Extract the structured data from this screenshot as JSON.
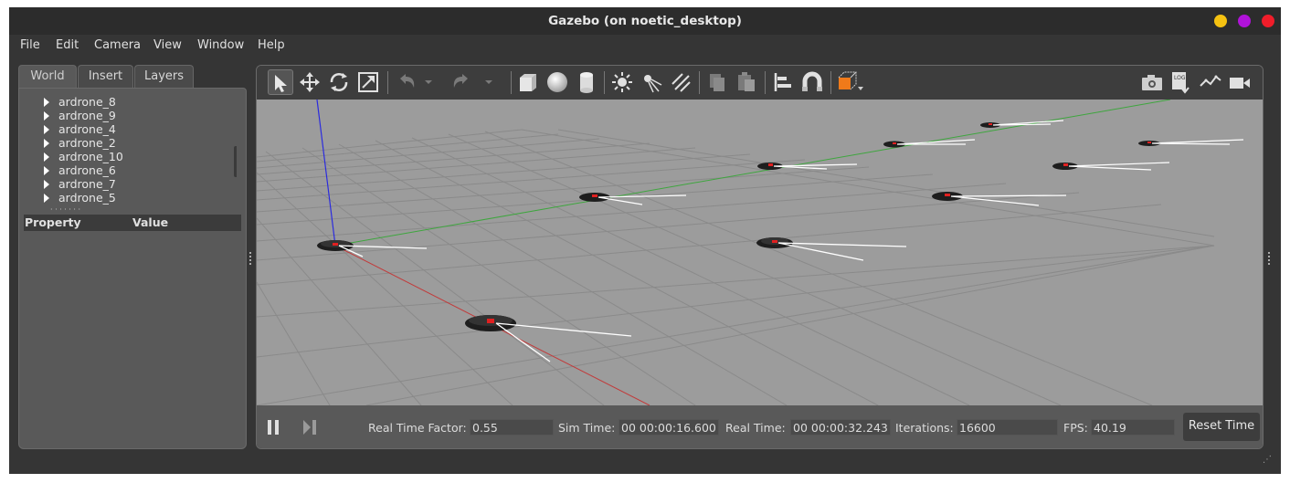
{
  "window": {
    "title": "Gazebo (on noetic_desktop)",
    "buttons": [
      {
        "name": "minimize",
        "color": "#f5c211"
      },
      {
        "name": "maximize",
        "color": "#b012d9"
      },
      {
        "name": "close",
        "color": "#f01d2a"
      }
    ]
  },
  "menu": [
    "File",
    "Edit",
    "Camera",
    "View",
    "Window",
    "Help"
  ],
  "left_panel": {
    "tabs": [
      "World",
      "Insert",
      "Layers"
    ],
    "active_tab": "World",
    "tree_items": [
      "ardrone_8",
      "ardrone_9",
      "ardrone_4",
      "ardrone_2",
      "ardrone_10",
      "ardrone_6",
      "ardrone_7",
      "ardrone_5"
    ],
    "property_header": {
      "property": "Property",
      "value": "Value"
    }
  },
  "toolbar": {
    "tools": [
      "select-mode",
      "translate-mode",
      "rotate-mode",
      "scale-mode",
      "undo",
      "undo-history",
      "redo",
      "redo-history",
      "box",
      "sphere",
      "cylinder",
      "point-light",
      "spot-light",
      "directional-light",
      "copy",
      "paste",
      "align",
      "snap",
      "view-angle"
    ],
    "right_tools": [
      "screenshot",
      "log",
      "plot",
      "record-video"
    ]
  },
  "status": {
    "real_time_factor_label": "Real Time Factor:",
    "real_time_factor": "0.55",
    "sim_time_label": "Sim Time:",
    "sim_time": "00 00:00:16.600",
    "real_time_label": "Real Time:",
    "real_time": "00 00:00:32.243",
    "iterations_label": "Iterations:",
    "iterations": "16600",
    "fps_label": "FPS:",
    "fps": "40.19",
    "reset_label": "Reset Time"
  },
  "colors": {
    "x_axis": "#c23a3a",
    "y_axis": "#3ea63e",
    "z_axis": "#2a2adf",
    "drone_marker": "#e02020",
    "accent_orange": "#f07a1a"
  }
}
